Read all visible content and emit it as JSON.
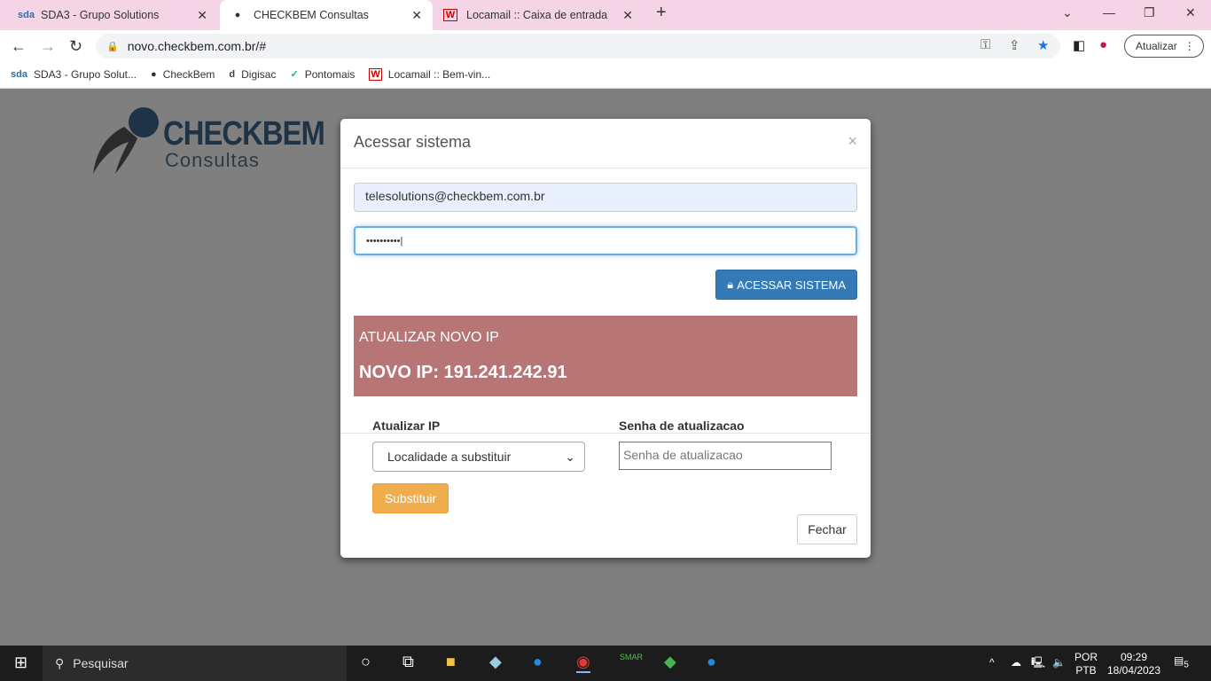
{
  "browser": {
    "tabs": [
      {
        "label": "SDA3 - Grupo Solutions",
        "icon": "sda-icon"
      },
      {
        "label": "CHECKBEM Consultas",
        "icon": "globe-icon",
        "active": true
      },
      {
        "label": "Locamail :: Caixa de entrada",
        "icon": "locamail-icon"
      }
    ],
    "url": "novo.checkbem.com.br/#",
    "update_label": "Atualizar",
    "bookmarks": [
      {
        "label": "SDA3 - Grupo Solut...",
        "icon": "sda-icon"
      },
      {
        "label": "CheckBem",
        "icon": "globe-icon"
      },
      {
        "label": "Digisac",
        "icon": "digisac-icon"
      },
      {
        "label": "Pontomais",
        "icon": "check-icon"
      },
      {
        "label": "Locamail :: Bem-vin...",
        "icon": "locamail-icon"
      }
    ]
  },
  "logo": {
    "brand": "CHECKBEM",
    "sub": "Consultas"
  },
  "modal": {
    "title": "Acessar sistema",
    "email": "telesolutions@checkbem.com.br",
    "password": "••••••••••",
    "login_button": "ACESSAR SISTEMA",
    "alert_title": "ATUALIZAR NOVO IP",
    "alert_ip": "NOVO IP: 191.241.242.91",
    "update_ip_label": "Atualizar IP",
    "select_value": "Localidade a substituir",
    "update_pw_label": "Senha de atualizacao",
    "update_pw_placeholder": "Senha de atualizacao",
    "replace_button": "Substituir",
    "close_button": "Fechar",
    "colors": {
      "primary": "#337ab7",
      "alert": "#b77575",
      "warning": "#f0ad4e"
    }
  },
  "taskbar": {
    "search": "Pesquisar",
    "lang1": "POR",
    "lang2": "PTB",
    "time": "09:29",
    "date": "18/04/2023",
    "notifications": "5"
  }
}
